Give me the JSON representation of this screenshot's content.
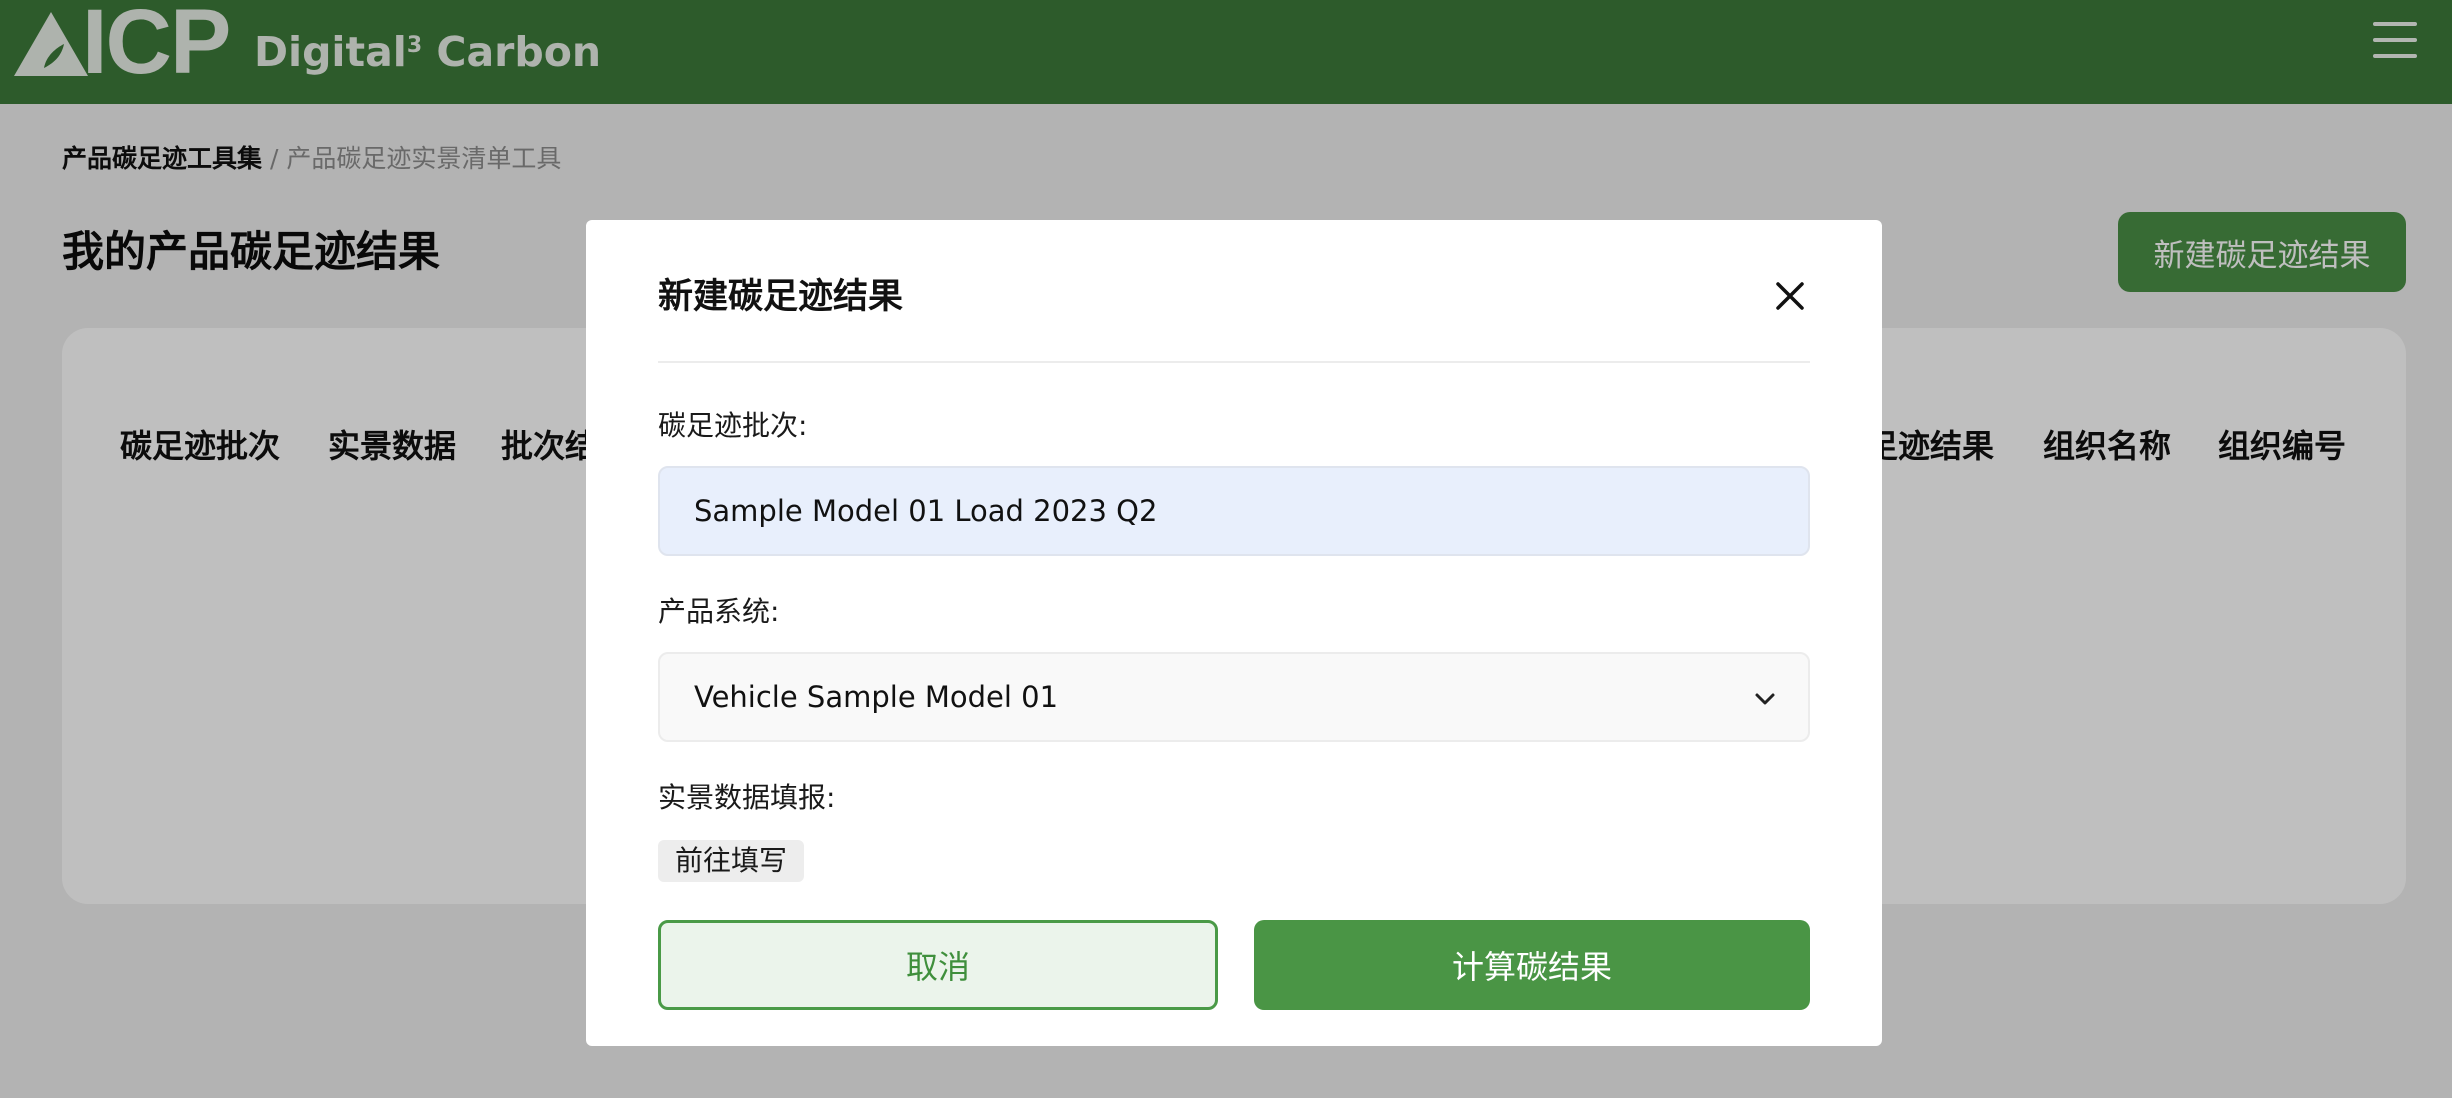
{
  "header": {
    "logo_text": "ICP",
    "brand_name": "Digital",
    "brand_sup": "3",
    "brand_suffix": " Carbon",
    "menu_icon": "hamburger-menu-icon"
  },
  "breadcrumb": {
    "root": "产品碳足迹工具集",
    "separator": " / ",
    "current": "产品碳足迹实景清单工具"
  },
  "page": {
    "title": "我的产品碳足迹结果",
    "new_button": "新建碳足迹结果"
  },
  "table": {
    "columns": [
      "碳足迹批次",
      "实景数据",
      "批次结",
      "足迹结果",
      "组织名称",
      "组织编号"
    ]
  },
  "modal": {
    "title": "新建碳足迹结果",
    "close_icon": "close-icon",
    "batch_label": "碳足迹批次:",
    "batch_value": "Sample Model 01 Load 2023 Q2",
    "system_label": "产品系统:",
    "system_value": "Vehicle Sample Model 01",
    "fill_label": "实景数据填报:",
    "fill_link": "前往填写",
    "cancel_button": "取消",
    "calculate_button": "计算碳结果"
  },
  "colors": {
    "header_green": "#3d7a3a",
    "primary_green": "#4a9545",
    "input_blue": "#e8effc"
  }
}
